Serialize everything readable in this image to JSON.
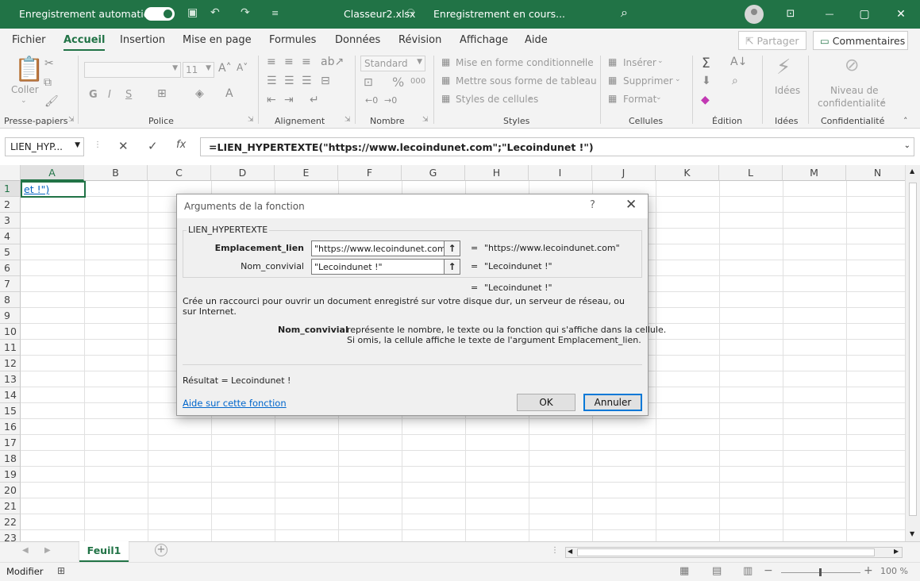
{
  "titlebar": {
    "autosave_label": "Enregistrement automatique",
    "toggle_state": "on",
    "filename": "Classeur2.xlsx",
    "status": "Enregistrement en cours...",
    "dropdown_glyph": "⌄",
    "minimize": "—",
    "restore": "▢",
    "close": "✕",
    "ribbon_display": "⊡"
  },
  "menu": {
    "tabs": [
      "Fichier",
      "Accueil",
      "Insertion",
      "Mise en page",
      "Formules",
      "Données",
      "Révision",
      "Affichage",
      "Aide"
    ],
    "active_tab": "Accueil",
    "share_label": "Partager",
    "comments_label": "Commentaires"
  },
  "ribbon": {
    "clipboard": {
      "paste": "Coller",
      "group": "Presse-papiers"
    },
    "font": {
      "size": "11",
      "bold": "G",
      "italic": "I",
      "underline": "S",
      "group": "Police"
    },
    "alignment": {
      "group": "Alignement"
    },
    "number": {
      "format": "Standard",
      "percent": "%",
      "thousands": "000",
      "group": "Nombre"
    },
    "styles": {
      "conditional": "Mise en forme conditionnelle",
      "table": "Mettre sous forme de tableau",
      "cell_styles": "Styles de cellules",
      "group": "Styles"
    },
    "cells": {
      "insert": "Insérer",
      "delete": "Supprimer",
      "format": "Format",
      "group": "Cellules"
    },
    "editing": {
      "group": "Édition"
    },
    "ideas": {
      "label": "Idées",
      "group": "Idées"
    },
    "sensitivity": {
      "line1": "Niveau de",
      "line2": "confidentialité",
      "group": "Confidentialité"
    }
  },
  "formula_bar": {
    "name_box": "LIEN_HYP...",
    "fx": "fx",
    "formula": "=LIEN_HYPERTEXTE(\"https://www.lecoindunet.com\";\"Lecoindunet !\")"
  },
  "grid": {
    "columns": [
      "A",
      "B",
      "C",
      "D",
      "E",
      "F",
      "G",
      "H",
      "I",
      "J",
      "K",
      "L",
      "M",
      "N"
    ],
    "rows": [
      "1",
      "2",
      "3",
      "4",
      "5",
      "6",
      "7",
      "8",
      "9",
      "10",
      "11",
      "12",
      "13",
      "14",
      "15",
      "16",
      "17",
      "18",
      "19",
      "20",
      "21",
      "22",
      "23"
    ],
    "cell_a1": "et !\")"
  },
  "sheets": {
    "active": "Feuil1",
    "add": "+"
  },
  "status": {
    "mode": "Modifier",
    "zoom": "100 %"
  },
  "dialog": {
    "title": "Arguments de la fonction",
    "help_glyph": "?",
    "close_glyph": "✕",
    "function_name": "LIEN_HYPERTEXTE",
    "args": [
      {
        "label": "Emplacement_lien",
        "value": "\"https://www.lecoindunet.com\"",
        "result": "\"https://www.lecoindunet.com\""
      },
      {
        "label": "Nom_convivial",
        "value": "\"Lecoindunet !\"",
        "result": "\"Lecoindunet !\""
      }
    ],
    "equals": "=",
    "total_result": "\"Lecoindunet !\"",
    "description": "Crée un raccourci pour ouvrir un document enregistré sur votre disque dur, un serveur de réseau, ou sur Internet.",
    "arg_detail_name": "Nom_convivial",
    "arg_detail_line1": "représente le nombre, le texte ou la fonction qui s'affiche dans la cellule.",
    "arg_detail_line2": "Si omis, la cellule affiche le texte de l'argument Emplacement_lien.",
    "result_label": "Résultat =",
    "result_value": "Lecoindunet !",
    "help_link": "Aide sur cette fonction",
    "ok": "OK",
    "cancel": "Annuler"
  },
  "colors": {
    "excel_green": "#217346",
    "link_blue": "#0563c1",
    "dialog_bg": "#f0f0f0"
  }
}
